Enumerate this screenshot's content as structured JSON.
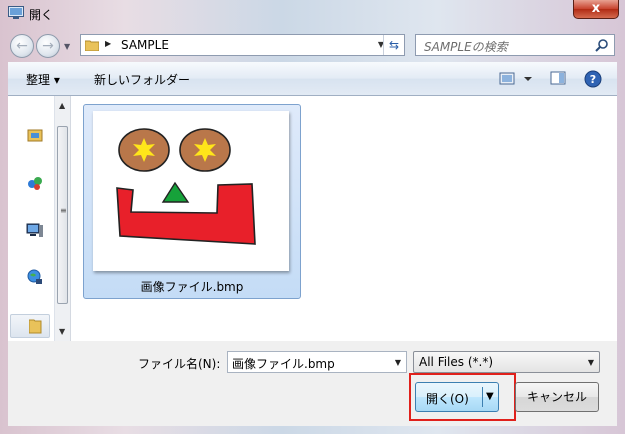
{
  "window": {
    "title": "開く",
    "close_label": "x"
  },
  "nav": {
    "back_icon": "back-arrow-icon",
    "forward_icon": "forward-arrow-icon",
    "address_path": "SAMPLE",
    "search_placeholder": "SAMPLEの検索"
  },
  "toolbar": {
    "organize_label": "整理 ▾",
    "new_folder_label": "新しいフォルダー"
  },
  "navpane": {
    "icons": [
      "favorites-icon",
      "libraries-icon",
      "computer-icon",
      "network-icon",
      "folder-icon"
    ]
  },
  "files": [
    {
      "name": "画像ファイル.bmp",
      "thumbnail": "face-drawing"
    }
  ],
  "bottom": {
    "filename_label": "ファイル名(N):",
    "filename_value": "画像ファイル.bmp",
    "filetype_value": "All Files (*.*)",
    "open_label": "開く(O)",
    "cancel_label": "キャンセル"
  },
  "colors": {
    "highlight_box": "#e0201b",
    "selection_bg": "#c4dcf6",
    "thumb_eye": "#b9774a",
    "thumb_star": "#ffe51a",
    "thumb_triangle": "#16a23a",
    "thumb_mouth": "#e8202a"
  }
}
